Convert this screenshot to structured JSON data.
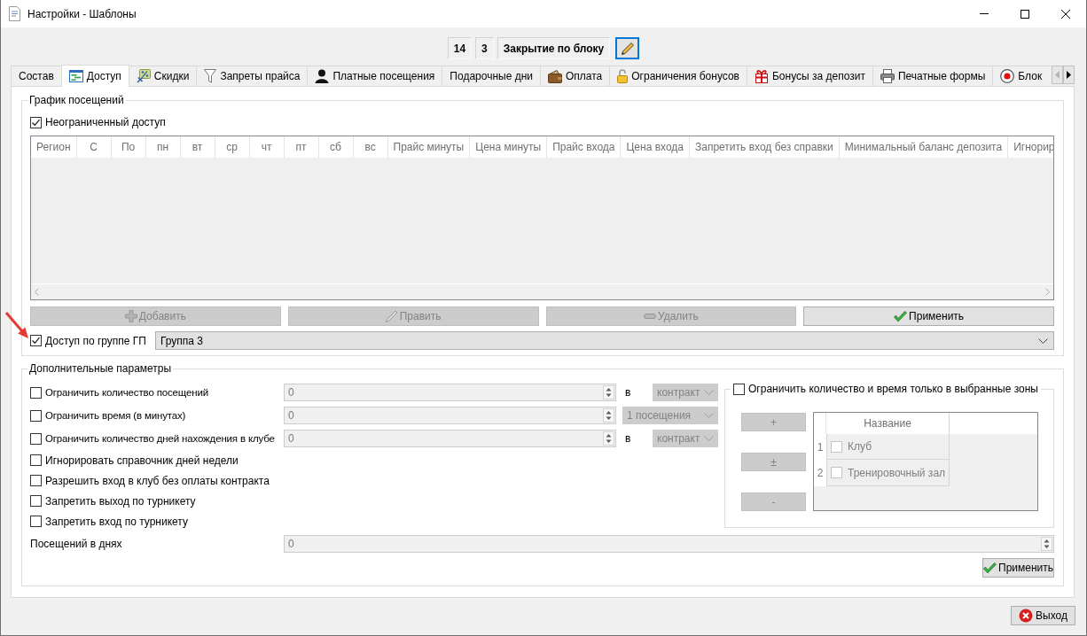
{
  "window": {
    "title": "Настройки - Шаблоны"
  },
  "header": {
    "fields": [
      "14",
      "3",
      "Закрытие по блоку"
    ]
  },
  "tabs": [
    {
      "label": "Состав",
      "selected": false
    },
    {
      "label": "Доступ",
      "selected": true
    },
    {
      "label": "Скидки",
      "selected": false
    },
    {
      "label": "Запреты прайса",
      "selected": false
    },
    {
      "label": "Платные посещения",
      "selected": false
    },
    {
      "label": "Подарочные дни",
      "selected": false
    },
    {
      "label": "Оплата",
      "selected": false
    },
    {
      "label": "Ограничения бонусов",
      "selected": false
    },
    {
      "label": "Бонусы за депозит",
      "selected": false
    },
    {
      "label": "Печатные формы",
      "selected": false
    },
    {
      "label": "Блок",
      "selected": false
    }
  ],
  "schedule": {
    "title": "График посещений",
    "unlimited": {
      "label": "Неограниченный доступ",
      "checked": true
    },
    "table": {
      "columns": [
        "Регион",
        "С",
        "По",
        "пн",
        "вт",
        "ср",
        "чт",
        "пт",
        "сб",
        "вс",
        "Прайс минуты",
        "Цена минуты",
        "Прайс входа",
        "Цена входа",
        "Запретить вход без справки",
        "Минимальный баланс депозита",
        "Игнорир"
      ]
    },
    "buttons": [
      {
        "label": "Добавить",
        "disabled": true
      },
      {
        "label": "Править",
        "disabled": true
      },
      {
        "label": "Удалить",
        "disabled": true
      },
      {
        "label": "Применить",
        "disabled": false
      }
    ],
    "group_access": {
      "label": "Доступ по группе ГП",
      "checked": true,
      "value": "Группа 3"
    }
  },
  "extra": {
    "title": "Дополнительные параметры",
    "options": [
      {
        "kind": "limit",
        "label": "Ограничить количество посещений",
        "checked": false,
        "value": "0",
        "unit": "в",
        "select": "контракт"
      },
      {
        "kind": "limit",
        "label": "Ограничить время (в минутах)",
        "checked": false,
        "value": "0",
        "select": "1 посещения"
      },
      {
        "kind": "limit",
        "label": "Ограничить количество дней нахождения в клубе",
        "checked": false,
        "value": "0",
        "unit": "в",
        "select": "контракт"
      },
      {
        "kind": "flag",
        "label": "Игнорировать справочник дней недели",
        "checked": false
      },
      {
        "kind": "flag",
        "label": "Разрешить вход в клуб без оплаты контракта",
        "checked": false
      },
      {
        "kind": "flag",
        "label": "Запретить выход по турникету",
        "checked": false
      },
      {
        "kind": "flag",
        "label": "Запретить вход по турникету",
        "checked": false
      }
    ],
    "visits_in_days": {
      "label": "Посещений в днях",
      "value": "0",
      "disabled": true
    },
    "zones": {
      "label": "Ограничить количество и время только в выбранные зоны",
      "checked": false,
      "buttons": [
        "+",
        "±",
        "-"
      ],
      "table": {
        "columns": [
          "Название"
        ],
        "rows": [
          {
            "number": "1",
            "name": "Клуб",
            "checked": false
          },
          {
            "number": "2",
            "name": "Тренировочный зал",
            "checked": false
          }
        ]
      }
    },
    "apply_button": "Применить"
  },
  "exit_button": "Выход"
}
